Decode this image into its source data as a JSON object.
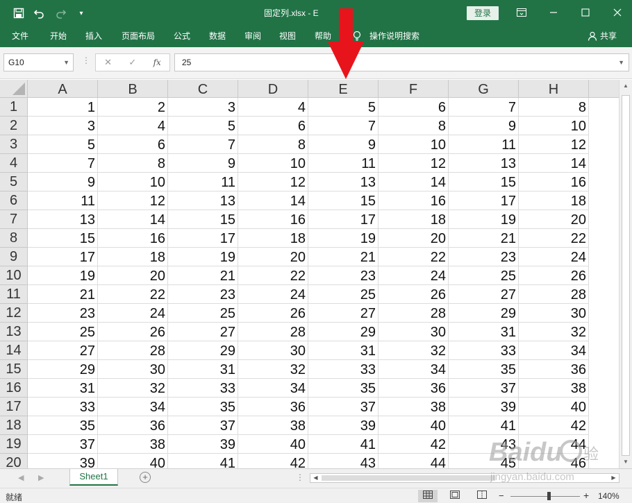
{
  "titlebar": {
    "filename": "固定列.xlsx  -  E",
    "login_label": "登录",
    "colors": {
      "brand": "#217346"
    },
    "icons": [
      "save-icon",
      "undo-icon",
      "redo-icon",
      "customize-qat-icon",
      "ribbon-display-icon",
      "minimize-icon",
      "maximize-icon",
      "close-icon"
    ]
  },
  "ribbon": {
    "tabs": [
      "文件",
      "开始",
      "插入",
      "页面布局",
      "公式",
      "数据",
      "审阅",
      "视图",
      "帮助"
    ],
    "tell_me": "操作说明搜索",
    "share": "共享"
  },
  "formula_bar": {
    "name_box": "G10",
    "formula": "25"
  },
  "sheet": {
    "columns": [
      "A",
      "B",
      "C",
      "D",
      "E",
      "F",
      "G",
      "H"
    ],
    "rows": [
      {
        "n": "1",
        "cells": [
          "1",
          "2",
          "3",
          "4",
          "5",
          "6",
          "7",
          "8"
        ]
      },
      {
        "n": "2",
        "cells": [
          "3",
          "4",
          "5",
          "6",
          "7",
          "8",
          "9",
          "10"
        ]
      },
      {
        "n": "3",
        "cells": [
          "5",
          "6",
          "7",
          "8",
          "9",
          "10",
          "11",
          "12"
        ]
      },
      {
        "n": "4",
        "cells": [
          "7",
          "8",
          "9",
          "10",
          "11",
          "12",
          "13",
          "14"
        ]
      },
      {
        "n": "5",
        "cells": [
          "9",
          "10",
          "11",
          "12",
          "13",
          "14",
          "15",
          "16"
        ]
      },
      {
        "n": "6",
        "cells": [
          "11",
          "12",
          "13",
          "14",
          "15",
          "16",
          "17",
          "18"
        ]
      },
      {
        "n": "7",
        "cells": [
          "13",
          "14",
          "15",
          "16",
          "17",
          "18",
          "19",
          "20"
        ]
      },
      {
        "n": "8",
        "cells": [
          "15",
          "16",
          "17",
          "18",
          "19",
          "20",
          "21",
          "22"
        ]
      },
      {
        "n": "9",
        "cells": [
          "17",
          "18",
          "19",
          "20",
          "21",
          "22",
          "23",
          "24"
        ]
      },
      {
        "n": "10",
        "cells": [
          "19",
          "20",
          "21",
          "22",
          "23",
          "24",
          "25",
          "26"
        ]
      },
      {
        "n": "11",
        "cells": [
          "21",
          "22",
          "23",
          "24",
          "25",
          "26",
          "27",
          "28"
        ]
      },
      {
        "n": "12",
        "cells": [
          "23",
          "24",
          "25",
          "26",
          "27",
          "28",
          "29",
          "30"
        ]
      },
      {
        "n": "13",
        "cells": [
          "25",
          "26",
          "27",
          "28",
          "29",
          "30",
          "31",
          "32"
        ]
      },
      {
        "n": "14",
        "cells": [
          "27",
          "28",
          "29",
          "30",
          "31",
          "32",
          "33",
          "34"
        ]
      },
      {
        "n": "15",
        "cells": [
          "29",
          "30",
          "31",
          "32",
          "33",
          "34",
          "35",
          "36"
        ]
      },
      {
        "n": "16",
        "cells": [
          "31",
          "32",
          "33",
          "34",
          "35",
          "36",
          "37",
          "38"
        ]
      },
      {
        "n": "17",
        "cells": [
          "33",
          "34",
          "35",
          "36",
          "37",
          "38",
          "39",
          "40"
        ]
      },
      {
        "n": "18",
        "cells": [
          "35",
          "36",
          "37",
          "38",
          "39",
          "40",
          "41",
          "42"
        ]
      },
      {
        "n": "19",
        "cells": [
          "37",
          "38",
          "39",
          "40",
          "41",
          "42",
          "43",
          "44"
        ]
      },
      {
        "n": "20",
        "cells": [
          "39",
          "40",
          "41",
          "42",
          "43",
          "44",
          "45",
          "46"
        ]
      }
    ]
  },
  "sheet_tabs": {
    "active": "Sheet1"
  },
  "status": {
    "ready": "就绪",
    "zoom": "140%"
  },
  "annotation": {
    "arrow_color": "#e8141c"
  },
  "watermark": {
    "line1": "Baidu经验",
    "line2": "jingyan.baidu.com"
  }
}
